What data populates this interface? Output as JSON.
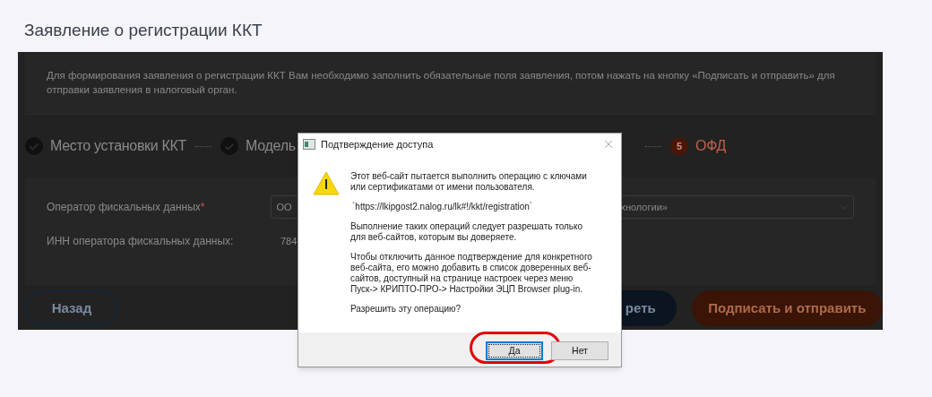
{
  "page": {
    "title": "Заявление о регистрации ККТ"
  },
  "intro": "Для формирования заявления о регистрации ККТ Вам необходимо заполнить обязательные поля заявления, потом нажать на кнопку «Подписать и отправить» для отправки заявления в налоговый орган.",
  "steps": [
    {
      "label": "Место установки ККТ",
      "completed": true
    },
    {
      "label": "Модель",
      "completed": true
    },
    {
      "label": "ОФД",
      "completed": false,
      "number": "5"
    }
  ],
  "fields": [
    {
      "label": "Оператор фискальных данных",
      "required_mark": "*",
      "kind": "select",
      "value_start": "ОО",
      "value_end": "хнологии»"
    },
    {
      "label": "ИНН оператора фискальных данных:",
      "kind": "text",
      "value_start": "784"
    }
  ],
  "buttons": [
    {
      "label": "Назад",
      "kind": "outline"
    },
    {
      "label": "реть",
      "kind": "primary"
    },
    {
      "label": "Подписать и отправить",
      "kind": "accent"
    }
  ],
  "dialog": {
    "title": "Подтверждение доступа",
    "paragraphs": [
      "Этот веб-сайт пытается выполнить операцию с ключами или сертификатами от имени пользователя.",
      "`https://lkipgost2.nalog.ru/lk#!/kkt/registration`",
      "Выполнение таких операций следует разрешать только для веб-сайтов, которым вы доверяете.",
      "Чтобы отключить данное подтверждение для конкретного веб-сайта, его можно добавить в список доверенных веб-сайтов, доступный на странице настроек через меню Пуск-> КРИПТО-ПРО-> Настройки ЭЦП Browser plug-in.",
      "Разрешить эту операцию?"
    ],
    "buttons": [
      {
        "label": "Да",
        "focused": true,
        "highlighted": true
      },
      {
        "label": "Нет",
        "focused": false,
        "highlighted": false
      }
    ]
  }
}
